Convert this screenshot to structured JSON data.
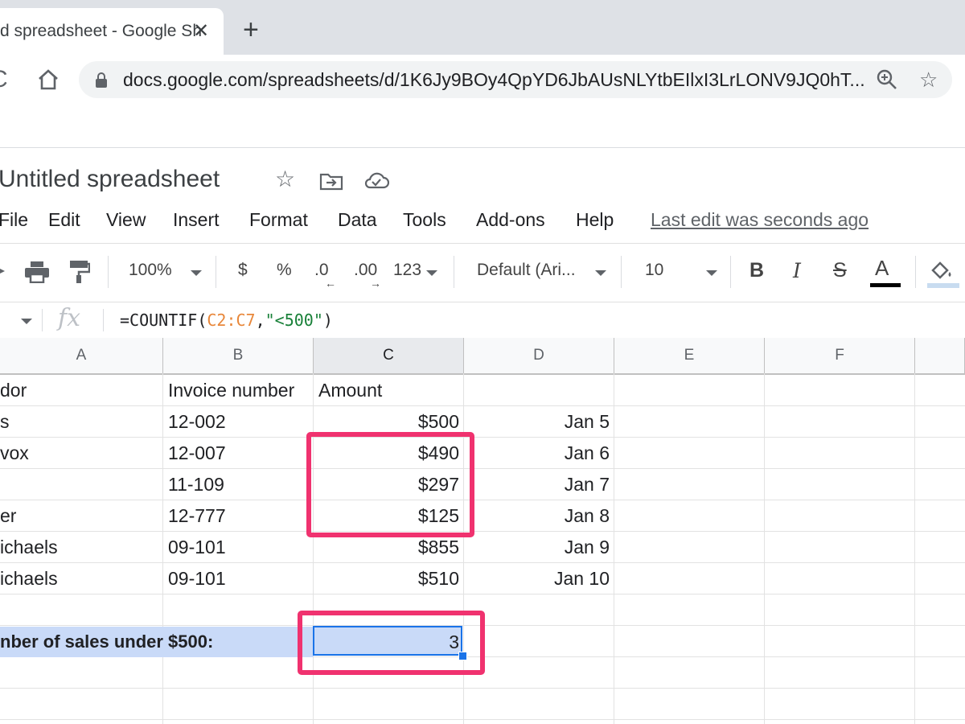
{
  "browser": {
    "tab_title": "d spreadsheet - Google Sh",
    "tab_close": "✕",
    "new_tab": "+",
    "url": "docs.google.com/spreadsheets/d/1K6Jy9BOy4QpYD6JbAUsNLYtbEIlxI3LrLONV9JQ0hT...",
    "reload": "C",
    "star": "☆"
  },
  "doc": {
    "title": "Untitled spreadsheet",
    "title_star": "☆",
    "last_edit": "Last edit was seconds ago"
  },
  "menu": [
    "File",
    "Edit",
    "View",
    "Insert",
    "Format",
    "Data",
    "Tools",
    "Add-ons",
    "Help"
  ],
  "toolbar": {
    "zoom": "100%",
    "currency": "$",
    "percent": "%",
    "decrease_decimal": ".0",
    "increase_decimal": ".00",
    "more_formats": "123",
    "font": "Default (Ari...",
    "font_size": "10",
    "bold": "B",
    "italic": "I",
    "strike": "S",
    "text_color": "A"
  },
  "formula_bar": {
    "fx": "fx",
    "prefix": "=COUNTIF(",
    "range": "C2:C7",
    "comma": ",",
    "criteria": "\"<500\"",
    "suffix": ")"
  },
  "columns": [
    "A",
    "B",
    "C",
    "D",
    "E",
    "F"
  ],
  "rows": [
    {
      "a": "dor",
      "b": "Invoice number",
      "c": "Amount",
      "d": ""
    },
    {
      "a": "s",
      "b": "12-002",
      "c": "$500",
      "d": "Jan 5"
    },
    {
      "a": "vox",
      "b": "12-007",
      "c": "$490",
      "d": "Jan 6"
    },
    {
      "a": "",
      "b": "11-109",
      "c": "$297",
      "d": "Jan 7"
    },
    {
      "a": "er",
      "b": "12-777",
      "c": "$125",
      "d": "Jan 8"
    },
    {
      "a": "ichaels",
      "b": "09-101",
      "c": "$855",
      "d": "Jan 9"
    },
    {
      "a": "ichaels",
      "b": "09-101",
      "c": "$510",
      "d": "Jan 10"
    }
  ],
  "summary": {
    "label": "nber of sales under $500:",
    "value": "3"
  },
  "colors": {
    "highlight": "#f0326f",
    "selection": "#c9daf8",
    "accent": "#1a73e8"
  }
}
